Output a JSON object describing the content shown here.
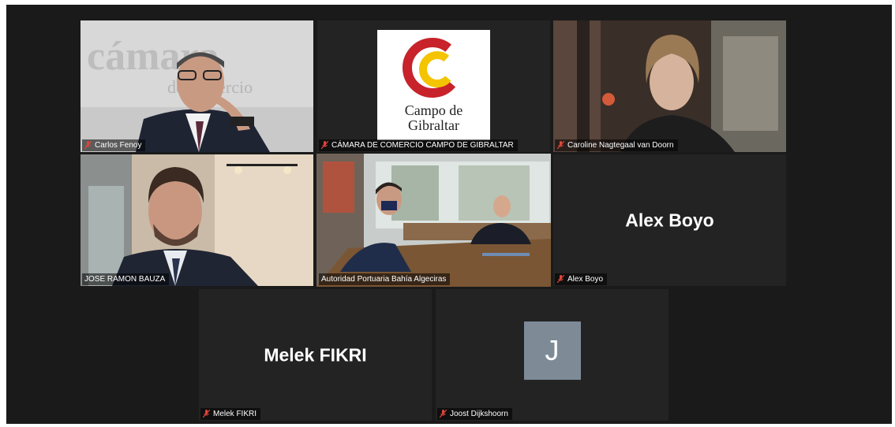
{
  "participants": {
    "p1": {
      "name": "Carlos Fenoy",
      "backdrop_text": "cámara de comercio"
    },
    "p2": {
      "name": "CÁMARA DE COMERCIO CAMPO DE GIBRALTAR",
      "logo_line1": "Campo de",
      "logo_line2": "Gibraltar"
    },
    "p3": {
      "name": "Caroline Nagtegaal van Doorn"
    },
    "p4": {
      "name": "JOSE RAMON BAUZA"
    },
    "p5": {
      "name": "Autoridad Portuaria Bahía Algeciras",
      "active_speaker": true
    },
    "p6": {
      "name": "Alex Boyo",
      "display": "Alex Boyo"
    },
    "p7": {
      "name": "Melek FIKRI",
      "display": "Melek FIKRI"
    },
    "p8": {
      "name": "Joost Dijkshoorn",
      "initial": "J"
    }
  },
  "colors": {
    "stage_bg": "#1a1a1a",
    "tile_bg": "#232323",
    "active_border": "#b8d86a",
    "muted_icon": "#e0453a",
    "avatar_bg": "#7e8b97"
  }
}
